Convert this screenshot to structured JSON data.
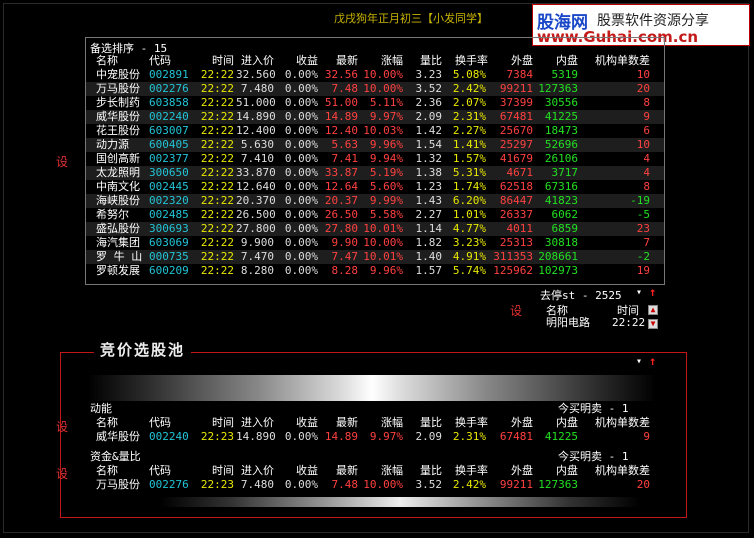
{
  "top_note": "戊戌狗年正月初三【小发同学】",
  "brand": {
    "logo": "股海网",
    "slogan": "股票软件资源分享",
    "url": "www.Guhai.com.cn"
  },
  "set_label": "设",
  "watchlist": {
    "title": "备选排序 - 15",
    "headers": [
      "名称",
      "代码",
      "时间",
      "进入价",
      "收益",
      "最新",
      "涨幅",
      "量比",
      "换手率",
      "外盘",
      "内盘",
      "机构单数差"
    ],
    "rows": [
      {
        "name": "中宠股份",
        "code": "002891",
        "time": "22:22",
        "price": "32.560",
        "profit": "0.00%",
        "latest": "32.56",
        "change": "10.00%",
        "vol_ratio": "3.23",
        "turnover": "5.08%",
        "outer": "7384",
        "inner": "5319",
        "diff": "10"
      },
      {
        "name": "万马股份",
        "code": "002276",
        "time": "22:22",
        "price": "7.480",
        "profit": "0.00%",
        "latest": "7.48",
        "change": "10.00%",
        "vol_ratio": "3.52",
        "turnover": "2.42%",
        "outer": "99211",
        "inner": "127363",
        "diff": "20"
      },
      {
        "name": "步长制药",
        "code": "603858",
        "time": "22:22",
        "price": "51.000",
        "profit": "0.00%",
        "latest": "51.00",
        "change": "5.11%",
        "vol_ratio": "2.36",
        "turnover": "2.07%",
        "outer": "37399",
        "inner": "30556",
        "diff": "8"
      },
      {
        "name": "威华股份",
        "code": "002240",
        "time": "22:22",
        "price": "14.890",
        "profit": "0.00%",
        "latest": "14.89",
        "change": "9.97%",
        "vol_ratio": "2.09",
        "turnover": "2.31%",
        "outer": "67481",
        "inner": "41225",
        "diff": "9"
      },
      {
        "name": "花王股份",
        "code": "603007",
        "time": "22:22",
        "price": "12.400",
        "profit": "0.00%",
        "latest": "12.40",
        "change": "10.03%",
        "vol_ratio": "1.42",
        "turnover": "2.27%",
        "outer": "25670",
        "inner": "18473",
        "diff": "6"
      },
      {
        "name": "动力源",
        "code": "600405",
        "time": "22:22",
        "price": "5.630",
        "profit": "0.00%",
        "latest": "5.63",
        "change": "9.96%",
        "vol_ratio": "1.54",
        "turnover": "1.41%",
        "outer": "25297",
        "inner": "52696",
        "diff": "10"
      },
      {
        "name": "国创高新",
        "code": "002377",
        "time": "22:22",
        "price": "7.410",
        "profit": "0.00%",
        "latest": "7.41",
        "change": "9.94%",
        "vol_ratio": "1.32",
        "turnover": "1.57%",
        "outer": "41679",
        "inner": "26106",
        "diff": "4"
      },
      {
        "name": "太龙照明",
        "code": "300650",
        "time": "22:22",
        "price": "33.870",
        "profit": "0.00%",
        "latest": "33.87",
        "change": "5.19%",
        "vol_ratio": "1.38",
        "turnover": "5.31%",
        "outer": "4671",
        "inner": "3717",
        "diff": "4"
      },
      {
        "name": "中南文化",
        "code": "002445",
        "time": "22:22",
        "price": "12.640",
        "profit": "0.00%",
        "latest": "12.64",
        "change": "5.60%",
        "vol_ratio": "1.23",
        "turnover": "1.74%",
        "outer": "62518",
        "inner": "67316",
        "diff": "8"
      },
      {
        "name": "海峡股份",
        "code": "002320",
        "time": "22:22",
        "price": "20.370",
        "profit": "0.00%",
        "latest": "20.37",
        "change": "9.99%",
        "vol_ratio": "1.43",
        "turnover": "6.20%",
        "outer": "86447",
        "inner": "41823",
        "diff": "-19"
      },
      {
        "name": "希努尔",
        "code": "002485",
        "time": "22:22",
        "price": "26.500",
        "profit": "0.00%",
        "latest": "26.50",
        "change": "5.58%",
        "vol_ratio": "2.27",
        "turnover": "1.01%",
        "outer": "26337",
        "inner": "6062",
        "diff": "-5"
      },
      {
        "name": "盛弘股份",
        "code": "300693",
        "time": "22:22",
        "price": "27.800",
        "profit": "0.00%",
        "latest": "27.80",
        "change": "10.01%",
        "vol_ratio": "1.14",
        "turnover": "4.77%",
        "outer": "4011",
        "inner": "6859",
        "diff": "23"
      },
      {
        "name": "海汽集团",
        "code": "603069",
        "time": "22:22",
        "price": "9.900",
        "profit": "0.00%",
        "latest": "9.90",
        "change": "10.00%",
        "vol_ratio": "1.82",
        "turnover": "3.23%",
        "outer": "25313",
        "inner": "30818",
        "diff": "7"
      },
      {
        "name": "罗 牛 山",
        "code": "000735",
        "time": "22:22",
        "price": "7.470",
        "profit": "0.00%",
        "latest": "7.47",
        "change": "10.01%",
        "vol_ratio": "1.40",
        "turnover": "4.91%",
        "outer": "311353",
        "inner": "208661",
        "diff": "-2"
      },
      {
        "name": "罗顿发展",
        "code": "600209",
        "time": "22:22",
        "price": "8.280",
        "profit": "0.00%",
        "latest": "8.28",
        "change": "9.96%",
        "vol_ratio": "1.57",
        "turnover": "5.74%",
        "outer": "125962",
        "inner": "102973",
        "diff": "19"
      }
    ]
  },
  "limit_stop": {
    "title": "去停st - 2525",
    "headers": [
      "名称",
      "时间"
    ],
    "rows": [
      {
        "name": "明阳电路",
        "time": "22:22"
      }
    ]
  },
  "pool": {
    "title": "竞价选股池",
    "sections": [
      {
        "label": "动能",
        "right_title": "今买明卖 - 1",
        "headers": [
          "名称",
          "代码",
          "时间",
          "进入价",
          "收益",
          "最新",
          "涨幅",
          "量比",
          "换手率",
          "外盘",
          "内盘",
          "机构单数差"
        ],
        "row": {
          "name": "威华股份",
          "code": "002240",
          "time": "22:23",
          "price": "14.890",
          "profit": "0.00%",
          "latest": "14.89",
          "change": "9.97%",
          "vol_ratio": "2.09",
          "turnover": "2.31%",
          "outer": "67481",
          "inner": "41225",
          "diff": "9"
        }
      },
      {
        "label": "资金&量比",
        "right_title": "今买明卖 - 1",
        "headers": [
          "名称",
          "代码",
          "时间",
          "进入价",
          "收益",
          "最新",
          "涨幅",
          "量比",
          "换手率",
          "外盘",
          "内盘",
          "机构单数差"
        ],
        "row": {
          "name": "万马股份",
          "code": "002276",
          "time": "22:23",
          "price": "7.480",
          "profit": "0.00%",
          "latest": "7.48",
          "change": "10.00%",
          "vol_ratio": "3.52",
          "turnover": "2.42%",
          "outer": "99211",
          "inner": "127363",
          "diff": "20"
        }
      }
    ]
  },
  "colors": {
    "rise": "#ff4040",
    "fall": "#22e022",
    "code": "#22c4d6",
    "time": "#e8e800",
    "frame": "#c01818"
  }
}
